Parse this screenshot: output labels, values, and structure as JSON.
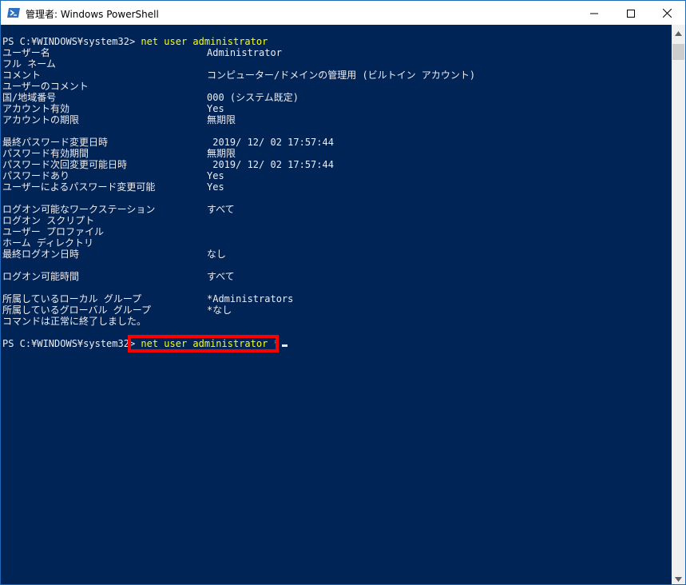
{
  "window": {
    "title": "管理者: Windows PowerShell",
    "icon": "powershell-icon",
    "controls": [
      "minimize-icon",
      "maximize-icon",
      "close-icon"
    ]
  },
  "colors": {
    "console_bg": "#012456",
    "console_text": "#eeedf0",
    "command": "#ffff00",
    "highlight_border": "#ff0000"
  },
  "console": {
    "prompt": "PS C:¥WINDOWS¥system32> ",
    "first_command": "net user administrator",
    "rows": [
      {
        "label": "ユーザー名",
        "value": "Administrator"
      },
      {
        "label": "フル ネーム",
        "value": ""
      },
      {
        "label": "コメント",
        "value": "コンピューター/ドメインの管理用 (ビルトイン アカウント)"
      },
      {
        "label": "ユーザーのコメント",
        "value": ""
      },
      {
        "label": "国/地域番号",
        "value": "000 (システム既定)"
      },
      {
        "label": "アカウント有効",
        "value": "Yes"
      },
      {
        "label": "アカウントの期限",
        "value": "無期限"
      },
      {
        "label": "",
        "value": ""
      },
      {
        "label": "最終パスワード変更日時",
        "value": " 2019/ 12/ 02 17:57:44"
      },
      {
        "label": "パスワード有効期間",
        "value": "無期限"
      },
      {
        "label": "パスワード次回変更可能日時",
        "value": " 2019/ 12/ 02 17:57:44"
      },
      {
        "label": "パスワードあり",
        "value": "Yes"
      },
      {
        "label": "ユーザーによるパスワード変更可能",
        "value": "Yes"
      },
      {
        "label": "",
        "value": ""
      },
      {
        "label": "ログオン可能なワークステーション",
        "value": "すべて"
      },
      {
        "label": "ログオン スクリプト",
        "value": ""
      },
      {
        "label": "ユーザー プロファイル",
        "value": ""
      },
      {
        "label": "ホーム ディレクトリ",
        "value": ""
      },
      {
        "label": "最終ログオン日時",
        "value": "なし"
      },
      {
        "label": "",
        "value": ""
      },
      {
        "label": "ログオン可能時間",
        "value": "すべて"
      },
      {
        "label": "",
        "value": ""
      },
      {
        "label": "所属しているローカル グループ",
        "value": "*Administrators"
      },
      {
        "label": "所属しているグローバル グループ",
        "value": "*なし"
      },
      {
        "label": "コマンドは正常に終了しました。",
        "value": ""
      }
    ],
    "second_command": "net user administrator",
    "second_arg": "*"
  }
}
